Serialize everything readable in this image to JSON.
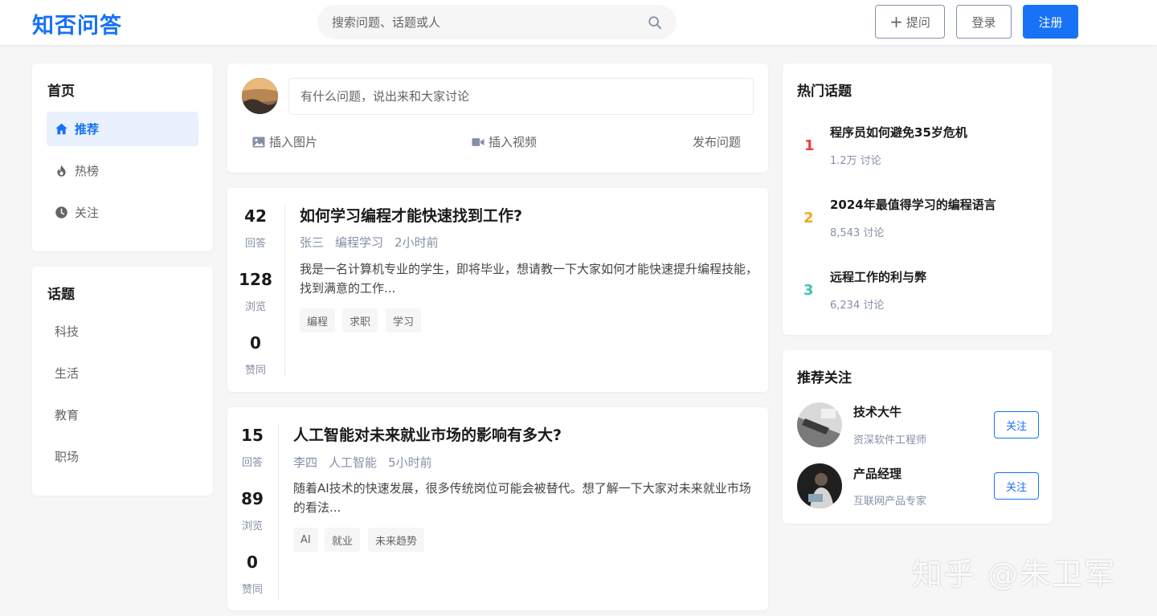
{
  "header": {
    "logo": "知否问答",
    "search_placeholder": "搜索问题、话题或人",
    "ask_label": "提问",
    "login_label": "登录",
    "register_label": "注册"
  },
  "nav": {
    "title": "首页",
    "items": [
      {
        "label": "推荐",
        "icon": "home-icon",
        "active": true
      },
      {
        "label": "热榜",
        "icon": "fire-icon",
        "active": false
      },
      {
        "label": "关注",
        "icon": "clock-icon",
        "active": false
      }
    ]
  },
  "topics": {
    "title": "话题",
    "items": [
      "科技",
      "生活",
      "教育",
      "职场"
    ]
  },
  "composer": {
    "placeholder": "有什么问题，说出来和大家讨论",
    "insert_image": "插入图片",
    "insert_video": "插入视频",
    "publish": "发布问题"
  },
  "questions": [
    {
      "answers": "42",
      "answers_label": "回答",
      "views": "128",
      "views_label": "浏览",
      "likes": "0",
      "likes_label": "赞同",
      "title": "如何学习编程才能快速找到工作?",
      "author": "张三",
      "topic": "编程学习",
      "time": "2小时前",
      "excerpt": "我是一名计算机专业的学生，即将毕业，想请教一下大家如何才能快速提升编程技能，找到满意的工作...",
      "tags": [
        "编程",
        "求职",
        "学习"
      ]
    },
    {
      "answers": "15",
      "answers_label": "回答",
      "views": "89",
      "views_label": "浏览",
      "likes": "0",
      "likes_label": "赞同",
      "title": "人工智能对未来就业市场的影响有多大?",
      "author": "李四",
      "topic": "人工智能",
      "time": "5小时前",
      "excerpt": "随着AI技术的快速发展，很多传统岗位可能会被替代。想了解一下大家对未来就业市场的看法...",
      "tags": [
        "AI",
        "就业",
        "未来趋势"
      ]
    }
  ],
  "hot": {
    "title": "热门话题",
    "items": [
      {
        "rank": "1",
        "title": "程序员如何避免35岁危机",
        "count": "1.2万 讨论",
        "color": "#f1403c"
      },
      {
        "rank": "2",
        "title": "2024年最值得学习的编程语言",
        "count": "8,543 讨论",
        "color": "#f5a623"
      },
      {
        "rank": "3",
        "title": "远程工作的利与弊",
        "count": "6,234 讨论",
        "color": "#42c4b3"
      }
    ]
  },
  "recommend": {
    "title": "推荐关注",
    "follow_label": "关注",
    "items": [
      {
        "name": "技术大牛",
        "desc": "资深软件工程师"
      },
      {
        "name": "产品经理",
        "desc": "互联网产品专家"
      }
    ]
  },
  "watermark": "知乎 @朱卫军",
  "colors": {
    "brand": "#1772f6",
    "bg": "#f6f6f6"
  }
}
